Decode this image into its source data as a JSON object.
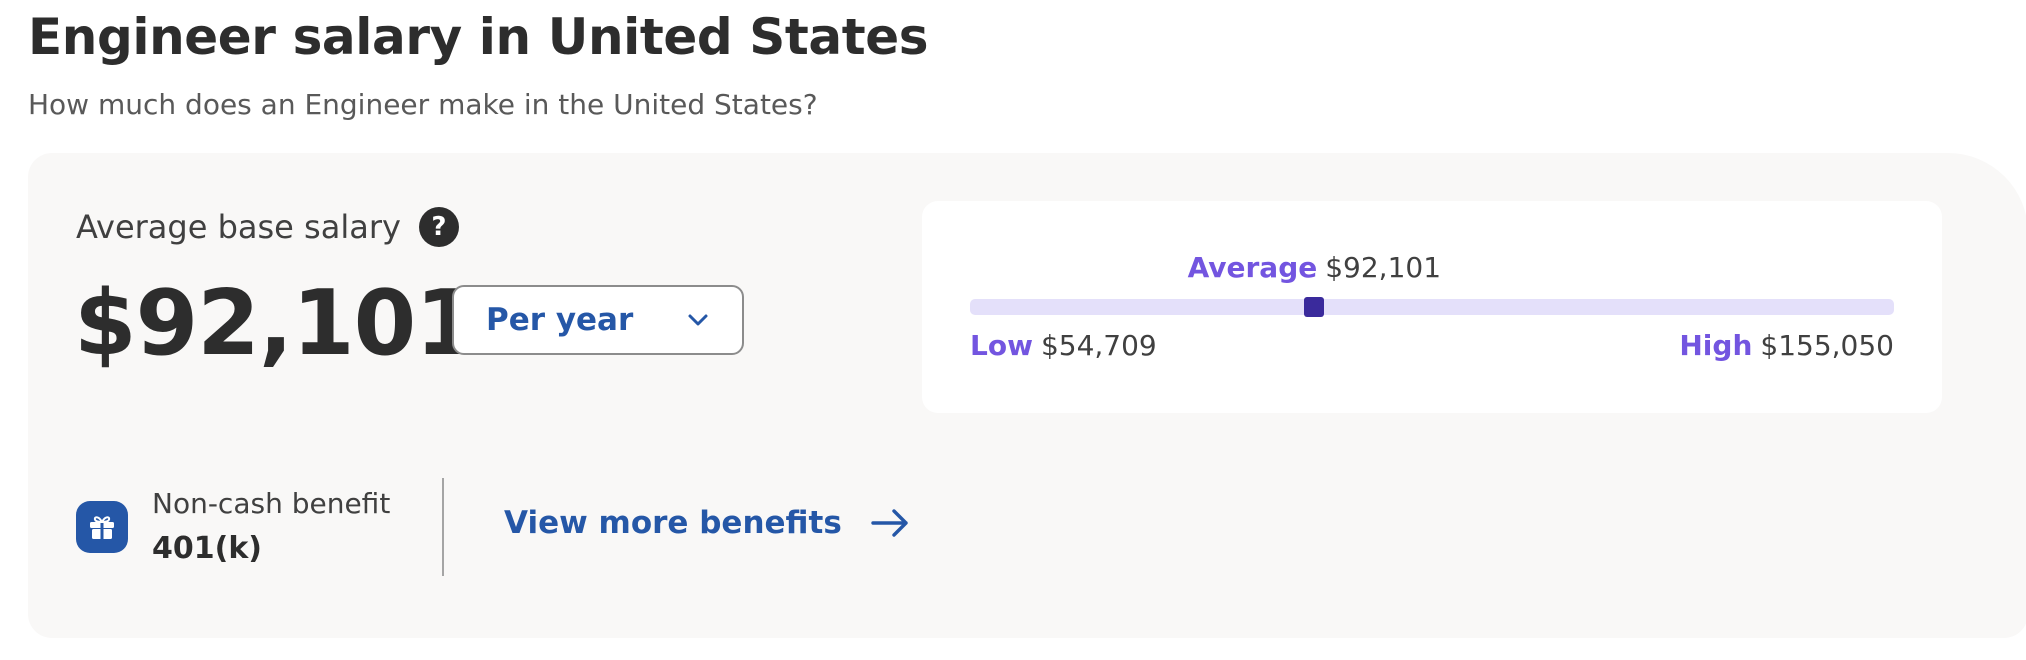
{
  "header": {
    "title": "Engineer salary in United States",
    "subtitle": "How much does an Engineer make in the United States?"
  },
  "salary": {
    "label": "Average base salary",
    "help_icon": "question-mark-icon",
    "help_glyph": "?",
    "value": "$92,101",
    "period": {
      "selected": "Per year",
      "icon": "chevron-down-icon"
    }
  },
  "range": {
    "average_label": "Average",
    "average_value": "$92,101",
    "low_label": "Low",
    "low_value": "$54,709",
    "high_label": "High",
    "high_value": "$155,050",
    "low_amount": 54709,
    "average_amount": 92101,
    "high_amount": 155050
  },
  "benefit": {
    "icon": "gift-icon",
    "caption": "Non-cash benefit",
    "value": "401(k)"
  },
  "more_benefits": {
    "label": "View more benefits",
    "icon": "arrow-right-icon"
  },
  "colors": {
    "primary_blue": "#2557a7",
    "accent_purple": "#7355e0",
    "track": "#e4e0fa",
    "marker": "#3a2a9c",
    "card_bg": "#f9f8f7"
  }
}
